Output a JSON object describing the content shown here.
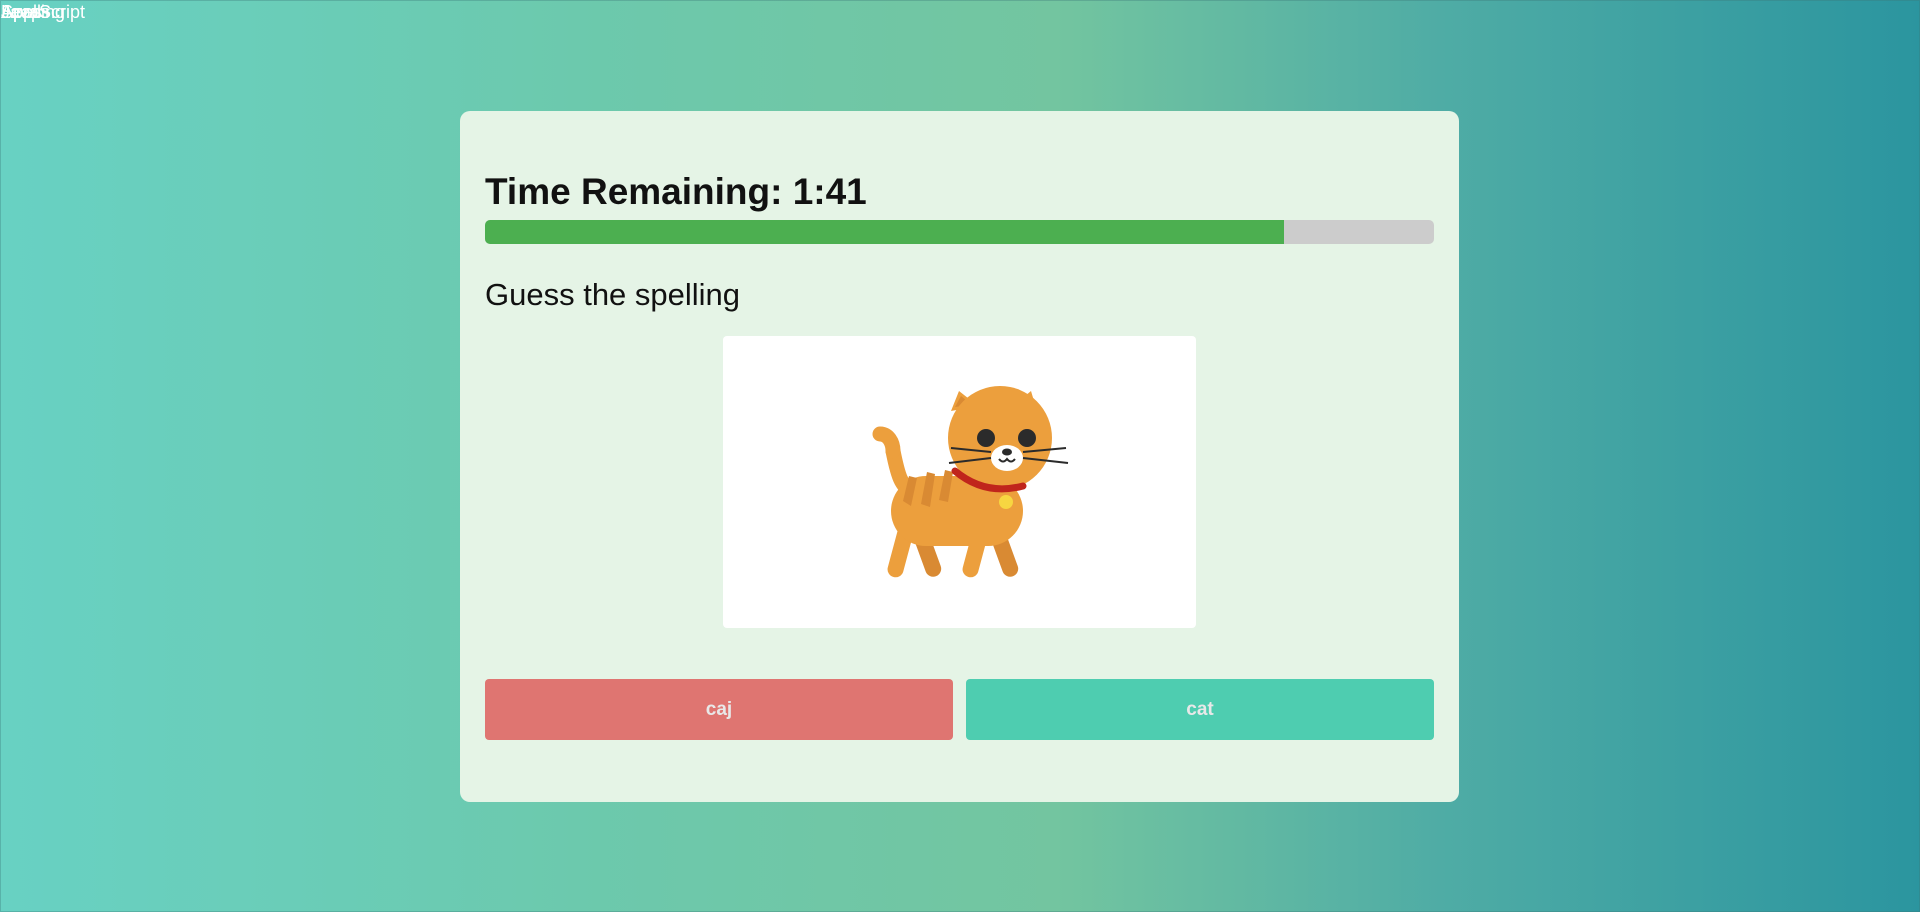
{
  "overlay_labels": [
    "JavaScript",
    "Leaps",
    "Spelling",
    "Apps"
  ],
  "timer": {
    "label": "Time Remaining: 1:41",
    "progress_fraction": 0.842
  },
  "prompt": "Guess the spelling",
  "picture": {
    "icon": "cat-icon",
    "colors": {
      "body": "#ec9f3d",
      "stripes": "#d98a33",
      "collar": "#c0251c",
      "bell": "#f7d641",
      "eyes": "#2b2b2b"
    }
  },
  "answers": [
    {
      "label": "caj",
      "color": "#df7571"
    },
    {
      "label": "cat",
      "color": "#4ecdb0"
    }
  ],
  "colors": {
    "progress_fill": "#4caf50",
    "progress_track": "#cccccc",
    "card_background": "#e5f4e6"
  }
}
